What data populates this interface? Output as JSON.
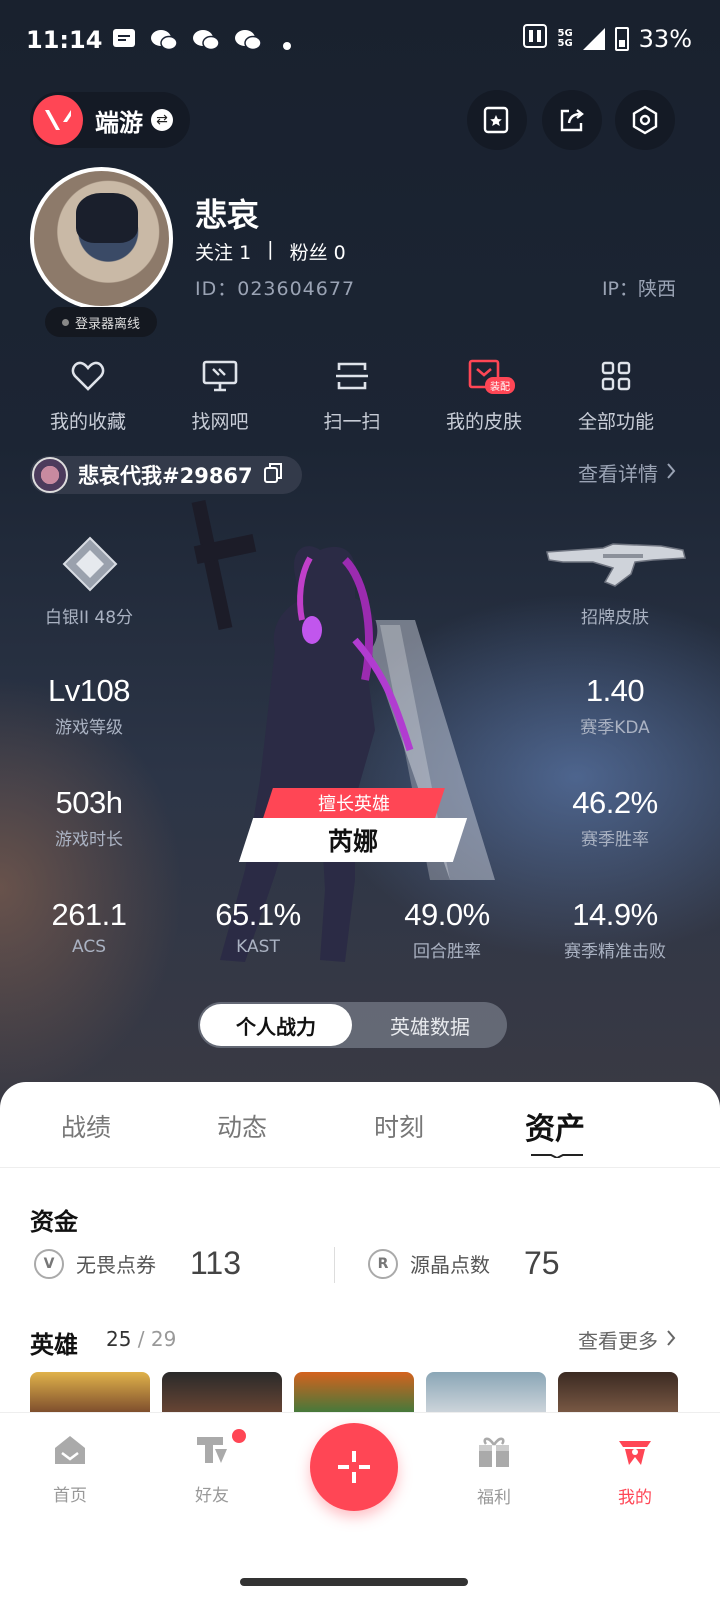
{
  "status_bar": {
    "time": "11:14",
    "network_top": "5G",
    "network_bottom": "5G",
    "battery": "33%"
  },
  "header": {
    "game_name": "端游"
  },
  "profile": {
    "name": "悲哀",
    "follow_label": "关注",
    "follow_count": "1",
    "separator": "|",
    "fans_label": "粉丝",
    "fans_count": "0",
    "id": "ID：023604677",
    "ip": "IP：陕西",
    "status": "登录器离线"
  },
  "shortcuts": [
    {
      "label": "我的收藏",
      "icon": "heart-icon"
    },
    {
      "label": "找网吧",
      "icon": "monitor-icon"
    },
    {
      "label": "扫一扫",
      "icon": "scan-icon"
    },
    {
      "label": "我的皮肤",
      "icon": "skin-icon",
      "tag": "装配"
    },
    {
      "label": "全部功能",
      "icon": "grid-icon"
    }
  ],
  "riot": {
    "id": "悲哀代我#29867",
    "view_detail": "查看详情"
  },
  "stats": {
    "rank_label": "白银II 48分",
    "skin_label": "招牌皮肤",
    "level": {
      "value": "Lv108",
      "label": "游戏等级"
    },
    "kda": {
      "value": "1.40",
      "label": "赛季KDA"
    },
    "playtime": {
      "value": "503h",
      "label": "游戏时长"
    },
    "winrate": {
      "value": "46.2%",
      "label": "赛季胜率"
    },
    "acs": {
      "value": "261.1",
      "label": "ACS"
    },
    "kast": {
      "value": "65.1%",
      "label": "KAST"
    },
    "round_win": {
      "value": "49.0%",
      "label": "回合胜率"
    },
    "headshot": {
      "value": "14.9%",
      "label": "赛季精准击败"
    },
    "fav_agent_tag": "擅长英雄",
    "fav_agent_name": "芮娜"
  },
  "toggle": {
    "active": "个人战力",
    "inactive": "英雄数据"
  },
  "tabs": [
    "战绩",
    "动态",
    "时刻",
    "资产"
  ],
  "funds": {
    "title": "资金",
    "vp_label": "无畏点券",
    "vp_value": "113",
    "rp_label": "源晶点数",
    "rp_value": "75"
  },
  "heroes": {
    "title": "英雄",
    "owned": "25",
    "total": "29",
    "see_more": "查看更多"
  },
  "nav": [
    {
      "label": "首页",
      "icon": "home-icon"
    },
    {
      "label": "好友",
      "icon": "friends-icon"
    },
    {
      "label": "福利",
      "icon": "gift-icon"
    },
    {
      "label": "我的",
      "icon": "profile-icon"
    }
  ],
  "colors": {
    "accent": "#ff4655",
    "bg_dark": "#1b2333"
  }
}
